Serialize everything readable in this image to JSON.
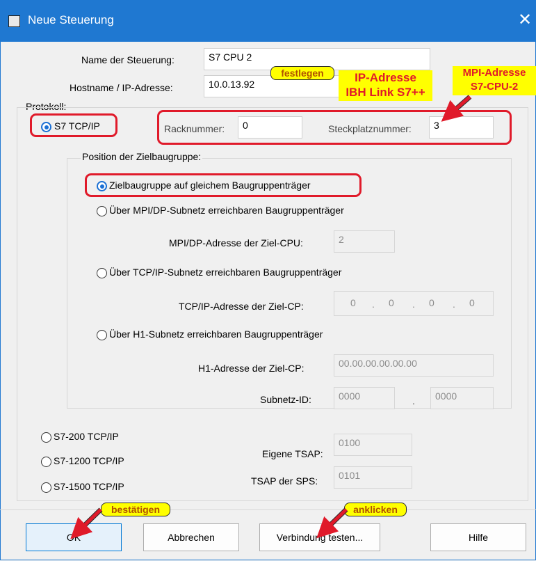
{
  "window": {
    "title": "Neue Steuerung",
    "close_glyph": "✕",
    "icon": "app-icon"
  },
  "form": {
    "name_label": "Name der Steuerung:",
    "name_value": "S7 CPU 2",
    "host_label": "Hostname / IP-Adresse:",
    "host_value": "10.0.13.92",
    "protocol_label": "Protokoll:",
    "s7_tcpip_label": "S7 TCP/IP",
    "rack_label": "Racknummer:",
    "rack_value": "0",
    "slot_label": "Steckplatznummer:",
    "slot_value": "3"
  },
  "position_group": {
    "label": "Position der Zielbaugruppe:",
    "opt_same_rack": "Zielbaugruppe auf gleichem Baugruppenträger",
    "opt_mpi": "Über MPI/DP-Subnetz erreichbaren Baugruppenträger",
    "mpi_addr_label": "MPI/DP-Adresse der Ziel-CPU:",
    "mpi_addr_value": "2",
    "opt_tcp": "Über TCP/IP-Subnetz erreichbaren Baugruppenträger",
    "tcp_addr_label": "TCP/IP-Adresse der Ziel-CP:",
    "ip_octets": [
      "0",
      "0",
      "0",
      "0"
    ],
    "ip_dot": ".",
    "opt_h1": "Über H1-Subnetz erreichbaren Baugruppenträger",
    "h1_addr_label": "H1-Adresse der Ziel-CP:",
    "h1_addr_value": "00.00.00.00.00.00",
    "subnet_label": "Subnetz-ID:",
    "subnet_value1": "0000",
    "subnet_sep": ".",
    "subnet_value2": "0000"
  },
  "other_protocols": {
    "s7_200": "S7-200 TCP/IP",
    "s7_1200": "S7-1200 TCP/IP",
    "s7_1500": "S7-1500 TCP/IP",
    "own_tsap_label": "Eigene TSAP:",
    "own_tsap_value": "0100",
    "plc_tsap_label": "TSAP der SPS:",
    "plc_tsap_value": "0101"
  },
  "buttons": {
    "ok": "OK",
    "cancel": "Abbrechen",
    "test": "Verbindung testen...",
    "help": "Hilfe"
  },
  "annotations": {
    "festlegen": "festlegen",
    "ip_line1": "IP-Adresse",
    "ip_line2": "IBH Link S7++",
    "mpi_line1": "MPI-Adresse",
    "mpi_line2": "S7-CPU-2",
    "bestaetigen": "bestätigen",
    "anklicken": "anklicken"
  },
  "colors": {
    "title_bar": "#1f78d1",
    "annotation_red": "#e01a2a",
    "annotation_yellow": "#ffff00",
    "radio_selected": "#1a6fd4"
  }
}
